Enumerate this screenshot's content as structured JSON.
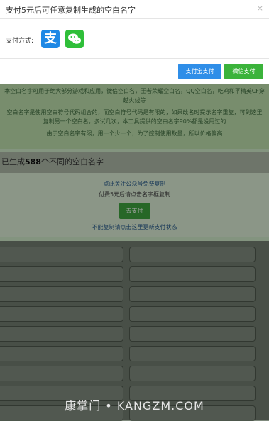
{
  "modal": {
    "title": "支付5元后可任意复制生成的空白名字",
    "close": "×",
    "payment_label": "支付方式:",
    "alipay_icon": "alipay-icon",
    "wechat_icon": "wechat-icon",
    "alipay_glyph": "支",
    "alipay_button": "支付宝支付",
    "wechat_button": "微信支付",
    "colors": {
      "alipay": "#2f8ee8",
      "wechat": "#3bb33b"
    }
  },
  "info": {
    "line1": "本空白名字可用于绝大部分游戏和应用，微信空白名，王者荣耀空白名，QQ空白名，吃鸡和平精英CF穿越火线等",
    "line2": "空白名字是使用空白符号代码组合的，而空白符号代码是有限的，如果改名时提示名字重复，可到这里复制另一个空白名，多试几次，本工具提供的空白名字90%都是没用过的",
    "line3": "由于空白名字有限，用一个少一个，为了控制使用数量，所以价格偏高"
  },
  "count": {
    "prefix": "已生成",
    "number": "588",
    "suffix": "个不同的空白名字"
  },
  "paybox": {
    "link1": "点此关注公众号免费复制",
    "line2": "付费5元后请点击名字框复制",
    "button": "去支付",
    "link3": "不能复制请点击这里更新支付状态"
  },
  "watermark": "康掌门 • KANGZM.COM"
}
